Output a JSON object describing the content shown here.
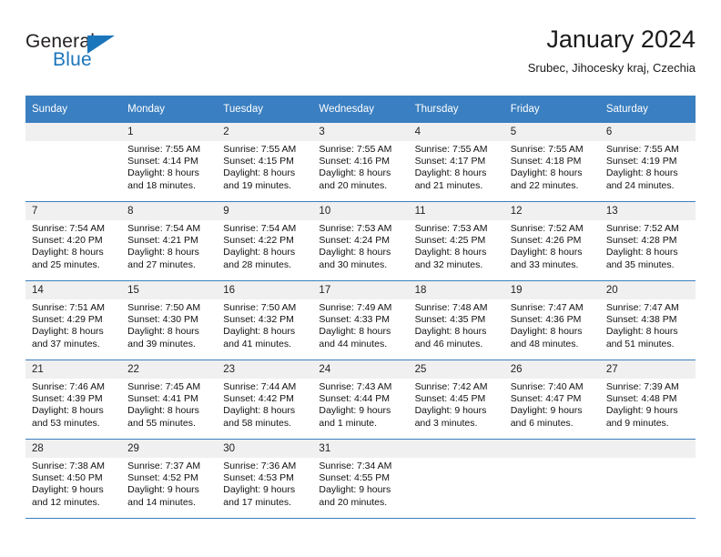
{
  "brand": {
    "logo_line1": "General",
    "logo_line2": "Blue",
    "triangle_icon": "blue-triangle-icon",
    "accent_color": "#1b75bb"
  },
  "header": {
    "title": "January 2024",
    "subtitle": "Srubec, Jihocesky kraj, Czechia"
  },
  "calendar": {
    "header_color": "#3a7fc1",
    "weekday_headers": [
      "Sunday",
      "Monday",
      "Tuesday",
      "Wednesday",
      "Thursday",
      "Friday",
      "Saturday"
    ],
    "weeks": [
      [
        {
          "day": "",
          "empty": true,
          "sunrise": "",
          "sunset": "",
          "daylight1": "",
          "daylight2": ""
        },
        {
          "day": "1",
          "sunrise": "Sunrise: 7:55 AM",
          "sunset": "Sunset: 4:14 PM",
          "daylight1": "Daylight: 8 hours",
          "daylight2": "and 18 minutes."
        },
        {
          "day": "2",
          "sunrise": "Sunrise: 7:55 AM",
          "sunset": "Sunset: 4:15 PM",
          "daylight1": "Daylight: 8 hours",
          "daylight2": "and 19 minutes."
        },
        {
          "day": "3",
          "sunrise": "Sunrise: 7:55 AM",
          "sunset": "Sunset: 4:16 PM",
          "daylight1": "Daylight: 8 hours",
          "daylight2": "and 20 minutes."
        },
        {
          "day": "4",
          "sunrise": "Sunrise: 7:55 AM",
          "sunset": "Sunset: 4:17 PM",
          "daylight1": "Daylight: 8 hours",
          "daylight2": "and 21 minutes."
        },
        {
          "day": "5",
          "sunrise": "Sunrise: 7:55 AM",
          "sunset": "Sunset: 4:18 PM",
          "daylight1": "Daylight: 8 hours",
          "daylight2": "and 22 minutes."
        },
        {
          "day": "6",
          "sunrise": "Sunrise: 7:55 AM",
          "sunset": "Sunset: 4:19 PM",
          "daylight1": "Daylight: 8 hours",
          "daylight2": "and 24 minutes."
        }
      ],
      [
        {
          "day": "7",
          "sunrise": "Sunrise: 7:54 AM",
          "sunset": "Sunset: 4:20 PM",
          "daylight1": "Daylight: 8 hours",
          "daylight2": "and 25 minutes."
        },
        {
          "day": "8",
          "sunrise": "Sunrise: 7:54 AM",
          "sunset": "Sunset: 4:21 PM",
          "daylight1": "Daylight: 8 hours",
          "daylight2": "and 27 minutes."
        },
        {
          "day": "9",
          "sunrise": "Sunrise: 7:54 AM",
          "sunset": "Sunset: 4:22 PM",
          "daylight1": "Daylight: 8 hours",
          "daylight2": "and 28 minutes."
        },
        {
          "day": "10",
          "sunrise": "Sunrise: 7:53 AM",
          "sunset": "Sunset: 4:24 PM",
          "daylight1": "Daylight: 8 hours",
          "daylight2": "and 30 minutes."
        },
        {
          "day": "11",
          "sunrise": "Sunrise: 7:53 AM",
          "sunset": "Sunset: 4:25 PM",
          "daylight1": "Daylight: 8 hours",
          "daylight2": "and 32 minutes."
        },
        {
          "day": "12",
          "sunrise": "Sunrise: 7:52 AM",
          "sunset": "Sunset: 4:26 PM",
          "daylight1": "Daylight: 8 hours",
          "daylight2": "and 33 minutes."
        },
        {
          "day": "13",
          "sunrise": "Sunrise: 7:52 AM",
          "sunset": "Sunset: 4:28 PM",
          "daylight1": "Daylight: 8 hours",
          "daylight2": "and 35 minutes."
        }
      ],
      [
        {
          "day": "14",
          "sunrise": "Sunrise: 7:51 AM",
          "sunset": "Sunset: 4:29 PM",
          "daylight1": "Daylight: 8 hours",
          "daylight2": "and 37 minutes."
        },
        {
          "day": "15",
          "sunrise": "Sunrise: 7:50 AM",
          "sunset": "Sunset: 4:30 PM",
          "daylight1": "Daylight: 8 hours",
          "daylight2": "and 39 minutes."
        },
        {
          "day": "16",
          "sunrise": "Sunrise: 7:50 AM",
          "sunset": "Sunset: 4:32 PM",
          "daylight1": "Daylight: 8 hours",
          "daylight2": "and 41 minutes."
        },
        {
          "day": "17",
          "sunrise": "Sunrise: 7:49 AM",
          "sunset": "Sunset: 4:33 PM",
          "daylight1": "Daylight: 8 hours",
          "daylight2": "and 44 minutes."
        },
        {
          "day": "18",
          "sunrise": "Sunrise: 7:48 AM",
          "sunset": "Sunset: 4:35 PM",
          "daylight1": "Daylight: 8 hours",
          "daylight2": "and 46 minutes."
        },
        {
          "day": "19",
          "sunrise": "Sunrise: 7:47 AM",
          "sunset": "Sunset: 4:36 PM",
          "daylight1": "Daylight: 8 hours",
          "daylight2": "and 48 minutes."
        },
        {
          "day": "20",
          "sunrise": "Sunrise: 7:47 AM",
          "sunset": "Sunset: 4:38 PM",
          "daylight1": "Daylight: 8 hours",
          "daylight2": "and 51 minutes."
        }
      ],
      [
        {
          "day": "21",
          "sunrise": "Sunrise: 7:46 AM",
          "sunset": "Sunset: 4:39 PM",
          "daylight1": "Daylight: 8 hours",
          "daylight2": "and 53 minutes."
        },
        {
          "day": "22",
          "sunrise": "Sunrise: 7:45 AM",
          "sunset": "Sunset: 4:41 PM",
          "daylight1": "Daylight: 8 hours",
          "daylight2": "and 55 minutes."
        },
        {
          "day": "23",
          "sunrise": "Sunrise: 7:44 AM",
          "sunset": "Sunset: 4:42 PM",
          "daylight1": "Daylight: 8 hours",
          "daylight2": "and 58 minutes."
        },
        {
          "day": "24",
          "sunrise": "Sunrise: 7:43 AM",
          "sunset": "Sunset: 4:44 PM",
          "daylight1": "Daylight: 9 hours",
          "daylight2": "and 1 minute."
        },
        {
          "day": "25",
          "sunrise": "Sunrise: 7:42 AM",
          "sunset": "Sunset: 4:45 PM",
          "daylight1": "Daylight: 9 hours",
          "daylight2": "and 3 minutes."
        },
        {
          "day": "26",
          "sunrise": "Sunrise: 7:40 AM",
          "sunset": "Sunset: 4:47 PM",
          "daylight1": "Daylight: 9 hours",
          "daylight2": "and 6 minutes."
        },
        {
          "day": "27",
          "sunrise": "Sunrise: 7:39 AM",
          "sunset": "Sunset: 4:48 PM",
          "daylight1": "Daylight: 9 hours",
          "daylight2": "and 9 minutes."
        }
      ],
      [
        {
          "day": "28",
          "sunrise": "Sunrise: 7:38 AM",
          "sunset": "Sunset: 4:50 PM",
          "daylight1": "Daylight: 9 hours",
          "daylight2": "and 12 minutes."
        },
        {
          "day": "29",
          "sunrise": "Sunrise: 7:37 AM",
          "sunset": "Sunset: 4:52 PM",
          "daylight1": "Daylight: 9 hours",
          "daylight2": "and 14 minutes."
        },
        {
          "day": "30",
          "sunrise": "Sunrise: 7:36 AM",
          "sunset": "Sunset: 4:53 PM",
          "daylight1": "Daylight: 9 hours",
          "daylight2": "and 17 minutes."
        },
        {
          "day": "31",
          "sunrise": "Sunrise: 7:34 AM",
          "sunset": "Sunset: 4:55 PM",
          "daylight1": "Daylight: 9 hours",
          "daylight2": "and 20 minutes."
        },
        {
          "day": "",
          "empty": true,
          "sunrise": "",
          "sunset": "",
          "daylight1": "",
          "daylight2": ""
        },
        {
          "day": "",
          "empty": true,
          "sunrise": "",
          "sunset": "",
          "daylight1": "",
          "daylight2": ""
        },
        {
          "day": "",
          "empty": true,
          "sunrise": "",
          "sunset": "",
          "daylight1": "",
          "daylight2": ""
        }
      ]
    ]
  }
}
